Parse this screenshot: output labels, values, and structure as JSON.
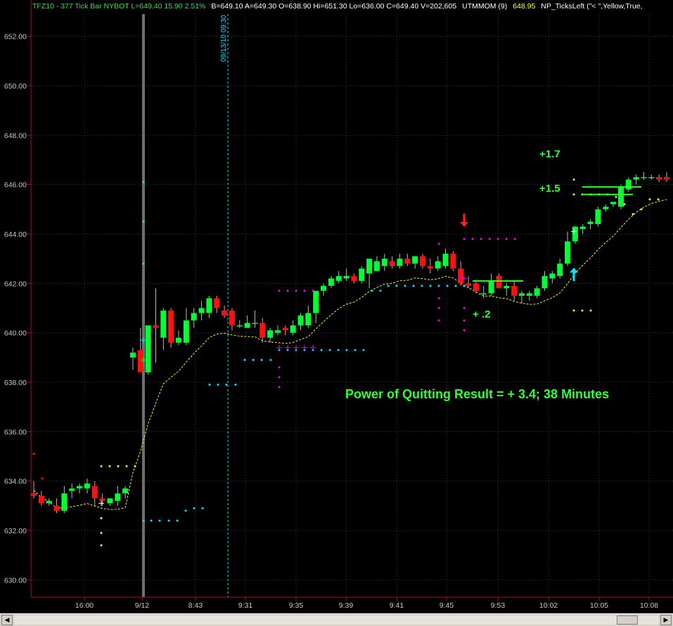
{
  "header": {
    "symbol": "TFZ10 - 377 Tick Bar  NYBOT  L=649.40  15.90  2.51%",
    "quote": "B=649.10  A=649.30  O=638.90  Hi=651.30  Lo=636.00  C=649.40  V=202,605",
    "indicator1": "UTMMOM (9)",
    "indicator2": "648.95",
    "indicator3": "NP_TicksLeft (\"< \",Yellow,True,"
  },
  "annotations": {
    "result": "Power of Quitting Result = + 3.4; 38 Minutes",
    "gain1": "+1.7",
    "gain2": "+1.5",
    "gain3": "+ .2",
    "session_marker": "09/13/10 09:30"
  },
  "colors": {
    "background": "#000000",
    "up_candle": "#00ff33",
    "down_candle": "#ff1111",
    "axis": "#cc0000",
    "grid": "#3a3a3a",
    "axis_text": "#c8c8c8",
    "signal_cyan": "#00e5ff",
    "signal_magenta": "#e011e0",
    "signal_yellow": "#ffee33",
    "annotation_green": "#33ff33"
  },
  "chart_data": {
    "type": "candlestick",
    "y_ticks": [
      "652.00",
      "650.00",
      "648.00",
      "646.00",
      "644.00",
      "642.00",
      "640.00",
      "638.00",
      "636.00",
      "634.00",
      "632.00",
      "630.00"
    ],
    "ylim": [
      629.3,
      652.9
    ],
    "x_labels": [
      "16:00",
      "9/12",
      "8:43",
      "9:31",
      "9:35",
      "9:39",
      "9:41",
      "9:45",
      "9:53",
      "10:02",
      "10:05",
      "10:08"
    ],
    "candles": [
      {
        "o": 633.5,
        "h": 634.0,
        "l": 633.3,
        "c": 633.4
      },
      {
        "o": 633.4,
        "h": 633.6,
        "l": 633.0,
        "c": 633.1
      },
      {
        "o": 633.1,
        "h": 633.3,
        "l": 633.0,
        "c": 633.2
      },
      {
        "o": 633.0,
        "h": 633.3,
        "l": 632.7,
        "c": 632.8
      },
      {
        "o": 632.8,
        "h": 633.8,
        "l": 632.7,
        "c": 633.5
      },
      {
        "o": 633.6,
        "h": 633.9,
        "l": 633.3,
        "c": 633.7
      },
      {
        "o": 633.7,
        "h": 633.9,
        "l": 633.5,
        "c": 633.8
      },
      {
        "o": 633.7,
        "h": 634.1,
        "l": 633.5,
        "c": 633.9
      },
      {
        "o": 633.8,
        "h": 634.0,
        "l": 633.0,
        "c": 633.3
      },
      {
        "o": 633.3,
        "h": 633.5,
        "l": 633.0,
        "c": 633.2
      },
      {
        "o": 633.1,
        "h": 633.3,
        "l": 633.0,
        "c": 633.3
      },
      {
        "o": 633.2,
        "h": 633.8,
        "l": 633.0,
        "c": 633.5
      },
      {
        "o": 633.5,
        "h": 633.8,
        "l": 633.3,
        "c": 633.7
      },
      {
        "o": 639.0,
        "h": 639.4,
        "l": 638.5,
        "c": 639.2
      },
      {
        "o": 639.3,
        "h": 640.2,
        "l": 638.4,
        "c": 638.4
      },
      {
        "o": 638.4,
        "h": 640.1,
        "l": 638.3,
        "c": 640.3
      },
      {
        "o": 640.3,
        "h": 641.8,
        "l": 638.8,
        "c": 640.2
      },
      {
        "o": 639.8,
        "h": 641.0,
        "l": 639.3,
        "c": 640.9
      },
      {
        "o": 640.9,
        "h": 641.0,
        "l": 639.4,
        "c": 639.6
      },
      {
        "o": 639.6,
        "h": 640.1,
        "l": 639.5,
        "c": 639.8
      },
      {
        "o": 639.6,
        "h": 641.0,
        "l": 639.5,
        "c": 640.5
      },
      {
        "o": 640.5,
        "h": 641.0,
        "l": 640.2,
        "c": 640.8
      },
      {
        "o": 640.8,
        "h": 641.3,
        "l": 640.5,
        "c": 641.0
      },
      {
        "o": 640.8,
        "h": 641.5,
        "l": 640.6,
        "c": 641.4
      },
      {
        "o": 641.4,
        "h": 641.5,
        "l": 640.8,
        "c": 641.0
      },
      {
        "o": 640.9,
        "h": 641.1,
        "l": 640.6,
        "c": 640.7
      },
      {
        "o": 640.9,
        "h": 641.0,
        "l": 640.1,
        "c": 640.3
      },
      {
        "o": 640.3,
        "h": 640.5,
        "l": 640.2,
        "c": 640.3
      },
      {
        "o": 640.2,
        "h": 640.7,
        "l": 640.2,
        "c": 640.4
      },
      {
        "o": 640.4,
        "h": 640.9,
        "l": 640.2,
        "c": 640.4
      },
      {
        "o": 640.4,
        "h": 640.6,
        "l": 639.6,
        "c": 639.8
      },
      {
        "o": 639.8,
        "h": 640.2,
        "l": 639.6,
        "c": 640.1
      },
      {
        "o": 640.0,
        "h": 640.3,
        "l": 639.9,
        "c": 640.1
      },
      {
        "o": 640.2,
        "h": 640.3,
        "l": 639.9,
        "c": 640.1
      },
      {
        "o": 640.0,
        "h": 640.5,
        "l": 639.9,
        "c": 640.3
      },
      {
        "o": 640.3,
        "h": 640.8,
        "l": 640.1,
        "c": 640.7
      },
      {
        "o": 640.3,
        "h": 641.1,
        "l": 640.2,
        "c": 640.8
      },
      {
        "o": 640.8,
        "h": 641.7,
        "l": 640.4,
        "c": 641.7
      },
      {
        "o": 641.7,
        "h": 642.0,
        "l": 641.5,
        "c": 641.9
      },
      {
        "o": 641.9,
        "h": 642.3,
        "l": 641.8,
        "c": 642.2
      },
      {
        "o": 642.1,
        "h": 642.5,
        "l": 642.0,
        "c": 642.3
      },
      {
        "o": 642.2,
        "h": 642.6,
        "l": 642.1,
        "c": 642.3
      },
      {
        "o": 642.3,
        "h": 642.4,
        "l": 642.0,
        "c": 642.1
      },
      {
        "o": 642.1,
        "h": 642.7,
        "l": 642.0,
        "c": 642.6
      },
      {
        "o": 642.4,
        "h": 643.0,
        "l": 641.8,
        "c": 643.0
      },
      {
        "o": 642.5,
        "h": 643.1,
        "l": 642.5,
        "c": 642.9
      },
      {
        "o": 642.7,
        "h": 643.2,
        "l": 642.5,
        "c": 643.0
      },
      {
        "o": 642.9,
        "h": 643.1,
        "l": 642.6,
        "c": 642.7
      },
      {
        "o": 642.7,
        "h": 643.2,
        "l": 642.6,
        "c": 643.0
      },
      {
        "o": 643.0,
        "h": 643.2,
        "l": 642.7,
        "c": 642.8
      },
      {
        "o": 642.8,
        "h": 643.0,
        "l": 642.6,
        "c": 643.1
      },
      {
        "o": 643.1,
        "h": 643.2,
        "l": 642.6,
        "c": 642.7
      },
      {
        "o": 642.7,
        "h": 643.0,
        "l": 642.4,
        "c": 642.6
      },
      {
        "o": 642.6,
        "h": 643.1,
        "l": 642.5,
        "c": 642.9
      },
      {
        "o": 642.7,
        "h": 643.4,
        "l": 642.6,
        "c": 643.2
      },
      {
        "o": 643.2,
        "h": 643.3,
        "l": 642.5,
        "c": 642.6
      },
      {
        "o": 642.6,
        "h": 642.9,
        "l": 641.9,
        "c": 642.0
      },
      {
        "o": 642.0,
        "h": 642.3,
        "l": 641.8,
        "c": 641.9
      },
      {
        "o": 642.0,
        "h": 642.1,
        "l": 641.6,
        "c": 641.7
      },
      {
        "o": 641.6,
        "h": 641.9,
        "l": 641.4,
        "c": 641.6
      },
      {
        "o": 641.6,
        "h": 642.4,
        "l": 641.5,
        "c": 642.1
      },
      {
        "o": 642.3,
        "h": 642.4,
        "l": 641.8,
        "c": 641.8
      },
      {
        "o": 641.8,
        "h": 642.0,
        "l": 641.5,
        "c": 641.9
      },
      {
        "o": 641.9,
        "h": 642.1,
        "l": 641.3,
        "c": 641.5
      },
      {
        "o": 641.5,
        "h": 641.7,
        "l": 641.2,
        "c": 641.6
      },
      {
        "o": 641.5,
        "h": 641.7,
        "l": 641.3,
        "c": 641.6
      },
      {
        "o": 641.5,
        "h": 641.9,
        "l": 641.4,
        "c": 641.8
      },
      {
        "o": 641.8,
        "h": 642.5,
        "l": 641.7,
        "c": 642.3
      },
      {
        "o": 642.2,
        "h": 642.5,
        "l": 642.0,
        "c": 642.4
      },
      {
        "o": 642.3,
        "h": 643.0,
        "l": 642.2,
        "c": 642.8
      },
      {
        "o": 642.8,
        "h": 644.1,
        "l": 642.7,
        "c": 643.7
      },
      {
        "o": 643.7,
        "h": 644.3,
        "l": 643.6,
        "c": 644.3
      },
      {
        "o": 644.2,
        "h": 644.4,
        "l": 644.0,
        "c": 644.3
      },
      {
        "o": 644.4,
        "h": 644.6,
        "l": 644.2,
        "c": 644.5
      },
      {
        "o": 644.4,
        "h": 645.1,
        "l": 644.3,
        "c": 645.0
      },
      {
        "o": 645.0,
        "h": 645.2,
        "l": 644.9,
        "c": 645.1
      },
      {
        "o": 645.2,
        "h": 645.3,
        "l": 645.1,
        "c": 645.3
      },
      {
        "o": 645.1,
        "h": 646.0,
        "l": 645.0,
        "c": 645.9
      },
      {
        "o": 645.8,
        "h": 646.3,
        "l": 645.7,
        "c": 646.2
      },
      {
        "o": 646.2,
        "h": 646.4,
        "l": 646.0,
        "c": 646.3
      },
      {
        "o": 646.3,
        "h": 646.5,
        "l": 646.2,
        "c": 646.3
      },
      {
        "o": 646.3,
        "h": 646.4,
        "l": 646.2,
        "c": 646.3
      },
      {
        "o": 646.3,
        "h": 646.4,
        "l": 646.1,
        "c": 646.2
      },
      {
        "o": 646.3,
        "h": 646.5,
        "l": 646.1,
        "c": 646.2
      }
    ]
  }
}
